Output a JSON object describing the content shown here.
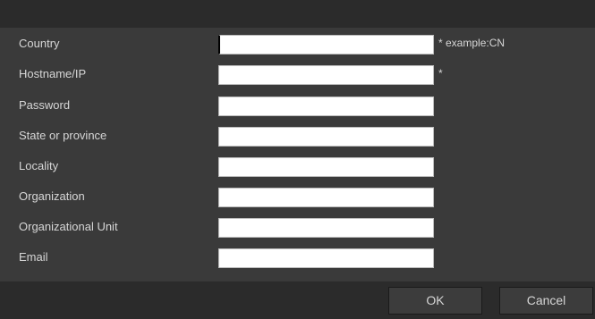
{
  "form": {
    "fields": [
      {
        "label": "Country",
        "value": "",
        "hint": "* example:CN"
      },
      {
        "label": "Hostname/IP",
        "value": "",
        "hint": "*"
      },
      {
        "label": "Password",
        "value": "",
        "hint": ""
      },
      {
        "label": "State or province",
        "value": "",
        "hint": ""
      },
      {
        "label": "Locality",
        "value": "",
        "hint": ""
      },
      {
        "label": "Organization",
        "value": "",
        "hint": ""
      },
      {
        "label": "Organizational Unit",
        "value": "",
        "hint": ""
      },
      {
        "label": "Email",
        "value": "",
        "hint": ""
      }
    ]
  },
  "footer": {
    "ok_label": "OK",
    "cancel_label": "Cancel"
  },
  "colors": {
    "dialog_bg": "#3a3a3a",
    "title_bar_bg": "#2b2b2b",
    "text": "#d6d6d6",
    "field_bg": "#ffffff"
  }
}
